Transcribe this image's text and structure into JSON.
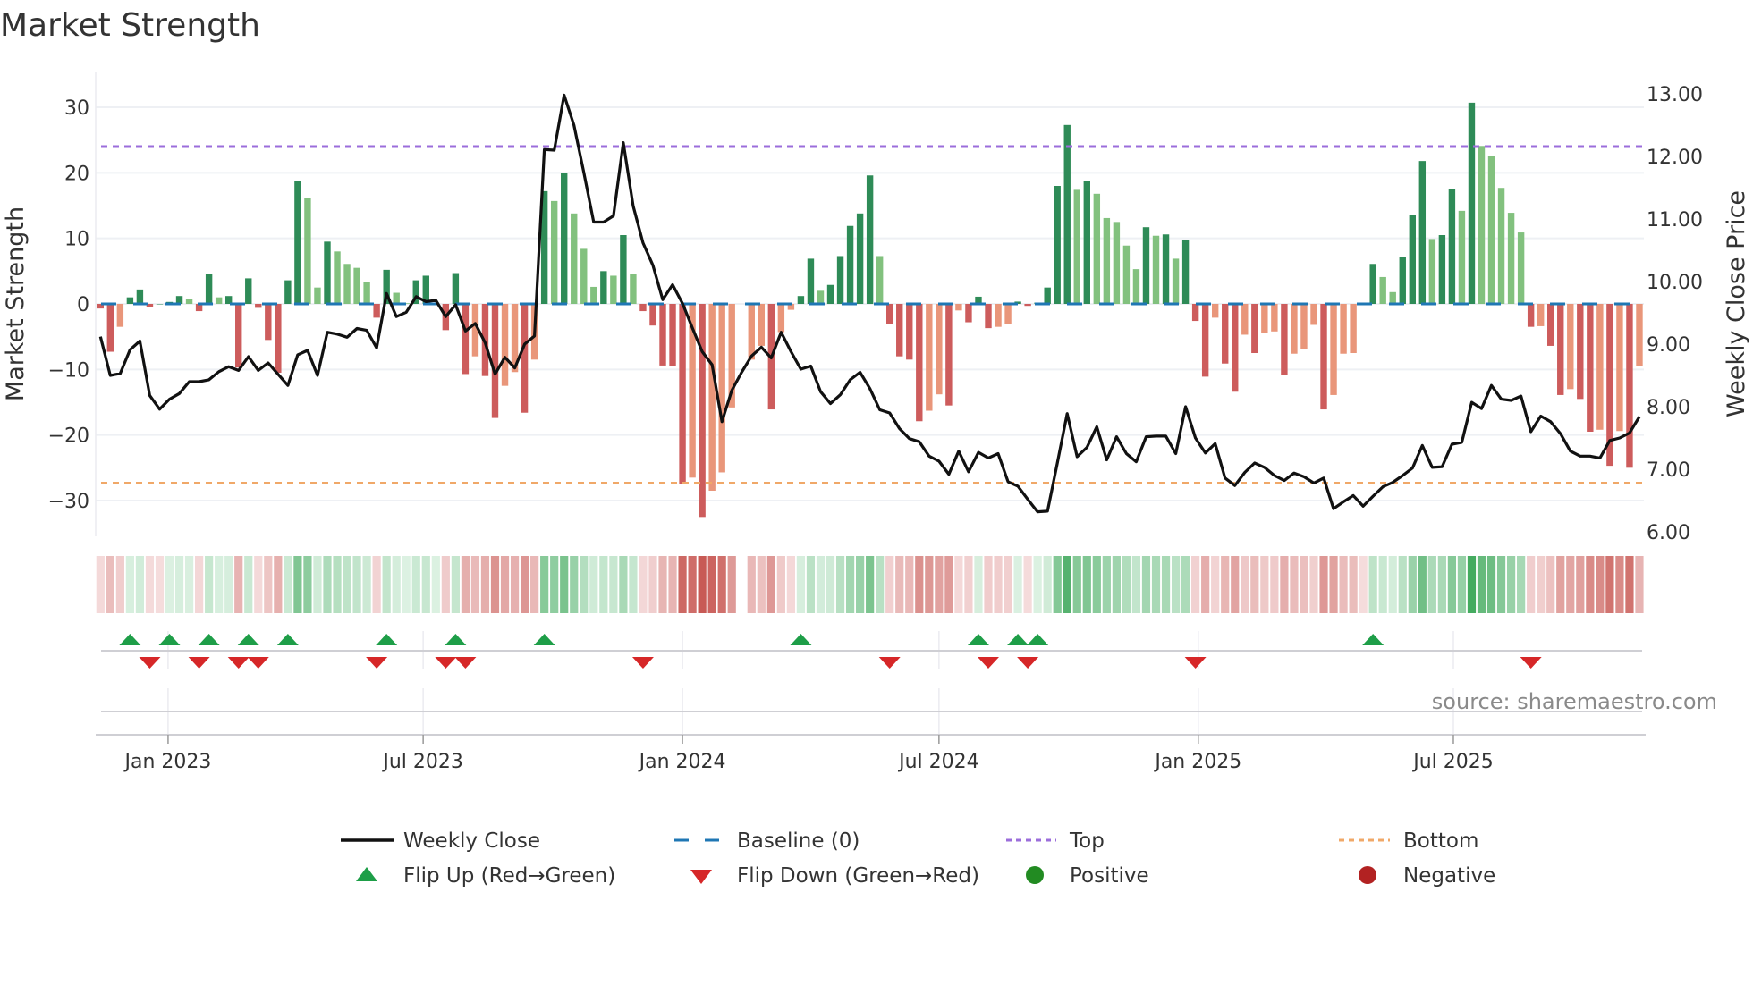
{
  "title": "Market Strength",
  "source": "source: sharemaestro.com",
  "colors": {
    "strong_up": "#2e8b57",
    "weak_up": "#82c17e",
    "strong_down": "#cd5c5c",
    "weak_down": "#e9967a",
    "baseline": "#1f77b4",
    "top": "#9b6ddb",
    "bottom": "#f0a868",
    "flip_up": "#1e9e48",
    "flip_down": "#d62728",
    "positive": "#228b22",
    "negative": "#b22222",
    "line": "#111111"
  },
  "legend": {
    "weekly_close": "Weekly Close",
    "baseline": "Baseline (0)",
    "top": "Top",
    "bottom": "Bottom",
    "flip_up": "Flip Up (Red→Green)",
    "flip_down": "Flip Down (Green→Red)",
    "positive": "Positive",
    "negative": "Negative"
  },
  "chart_data": {
    "type": "bar+line",
    "title": "Market Strength",
    "ylabel": "Market Strength",
    "y2label": "Weekly Close Price",
    "x_start": "2022-11-14",
    "x_step_days": 7,
    "ylim": [
      -35,
      35
    ],
    "y2lim": [
      5.72,
      13.35
    ],
    "y_ticks": [
      30,
      20,
      10,
      0,
      -10,
      -20,
      -30
    ],
    "y_tick_labels": [
      "30",
      "20",
      "10",
      "0",
      "−10",
      "−20",
      "−30"
    ],
    "y2_ticks": [
      13,
      12,
      11,
      10,
      9,
      8,
      7,
      6
    ],
    "y2_tick_labels": [
      "13.00",
      "12.00",
      "11.00",
      "10.00",
      "9.00",
      "8.00",
      "7.00",
      "6.00"
    ],
    "x_ticks": [
      "2023-01-01",
      "2023-07-01",
      "2024-01-01",
      "2024-07-01",
      "2025-01-01",
      "2025-07-01"
    ],
    "x_tick_labels": [
      "Jan 2023",
      "Jul 2023",
      "Jan 2024",
      "Jul 2024",
      "Jan 2025",
      "Jul 2025"
    ],
    "top_level": 24.0,
    "bottom_level": -27.3,
    "baseline": 0,
    "strength": [
      -0.7,
      -7.3,
      -3.5,
      1,
      2.2,
      -0.5,
      0,
      0.3,
      1.2,
      0.7,
      -1.1,
      4.5,
      1,
      1.2,
      -9.7,
      3.9,
      -0.6,
      -5.5,
      -10.5,
      3.6,
      18.8,
      16.1,
      2.5,
      9.5,
      8,
      6.1,
      5.5,
      3.3,
      -2.1,
      5.2,
      1.7,
      0.1,
      3.6,
      4.3,
      0.2,
      -4,
      4.7,
      -10.7,
      -8,
      -11,
      -17.4,
      -12.5,
      -10.4,
      -16.6,
      -8.5,
      17.2,
      15.7,
      20,
      13.8,
      8.4,
      2.6,
      5,
      4.3,
      10.5,
      4.6,
      -1.1,
      -3.3,
      -9.4,
      -9.5,
      -27.5,
      -26.5,
      -32.5,
      -28.5,
      -25.7,
      -15.8,
      null,
      -8.5,
      -6.4,
      -16.1,
      -4.3,
      -0.9,
      1.2,
      6.9,
      2,
      2.9,
      7.3,
      11.9,
      13.8,
      19.6,
      7.3,
      -3,
      -8,
      -8.5,
      -17.9,
      -16.3,
      -13.8,
      -15.5,
      -1,
      -2.8,
      1.1,
      -3.7,
      -3.5,
      -3,
      0.35,
      -0.3,
      0.2,
      2.5,
      18,
      27.3,
      17.4,
      18.8,
      16.8,
      13.1,
      12.5,
      8.9,
      5.3,
      11.7,
      10.4,
      10.6,
      6.9,
      9.8,
      -2.6,
      -11.1,
      -2.1,
      -9.1,
      -13.4,
      -4.7,
      -7.5,
      -4.5,
      -4.2,
      -10.9,
      -7.6,
      -6.9,
      -3.2,
      -16.1,
      -13.9,
      -7.6,
      -7.5,
      -0.1,
      6.1,
      4.1,
      1.8,
      7.2,
      13.5,
      21.8,
      9.9,
      10.5,
      17.5,
      14.2,
      30.7,
      24.1,
      22.6,
      17.7,
      13.9,
      10.9,
      -3.5,
      -3.4,
      -6.4,
      -13.9,
      -13,
      -14.5,
      -19.5,
      -19.2,
      -24.7,
      -19.4,
      -25,
      -9.5
    ],
    "weekly_close": [
      9.12,
      8.5,
      8.53,
      8.91,
      9.05,
      8.18,
      7.96,
      8.12,
      8.21,
      8.4,
      8.4,
      8.43,
      8.56,
      8.64,
      8.58,
      8.8,
      8.58,
      8.7,
      8.52,
      8.34,
      8.83,
      8.9,
      8.5,
      9.19,
      9.16,
      9.11,
      9.25,
      9.22,
      8.94,
      9.81,
      9.44,
      9.51,
      9.76,
      9.68,
      9.7,
      9.44,
      9.63,
      9.21,
      9.33,
      9.02,
      8.52,
      8.79,
      8.62,
      9.0,
      9.13,
      12.11,
      12.1,
      12.98,
      12.5,
      11.74,
      10.95,
      10.95,
      11.05,
      12.22,
      11.21,
      10.62,
      10.26,
      9.71,
      9.95,
      9.65,
      9.26,
      8.88,
      8.67,
      7.76,
      8.26,
      8.55,
      8.81,
      8.95,
      8.78,
      9.19,
      8.88,
      8.6,
      8.65,
      8.24,
      8.05,
      8.19,
      8.43,
      8.55,
      8.29,
      7.95,
      7.9,
      7.65,
      7.49,
      7.44,
      7.21,
      7.13,
      6.92,
      7.29,
      6.96,
      7.27,
      7.18,
      7.25,
      6.8,
      6.73,
      6.52,
      6.32,
      6.33,
      7.1,
      7.89,
      7.2,
      7.35,
      7.68,
      7.15,
      7.52,
      7.25,
      7.12,
      7.52,
      7.53,
      7.53,
      7.25,
      8.0,
      7.5,
      7.26,
      7.41,
      6.86,
      6.74,
      6.95,
      7.1,
      7.03,
      6.9,
      6.82,
      6.94,
      6.88,
      6.78,
      6.86,
      6.37,
      6.48,
      6.58,
      6.41,
      6.57,
      6.72,
      6.79,
      6.9,
      7.02,
      7.38,
      7.03,
      7.04,
      7.4,
      7.43,
      8.07,
      7.97,
      8.34,
      8.12,
      8.1,
      8.17,
      7.6,
      7.85,
      7.76,
      7.57,
      7.29,
      7.21,
      7.21,
      7.18,
      7.46,
      7.5,
      7.58,
      7.84
    ],
    "flip_up_weeks": [
      3,
      7,
      11,
      15,
      19,
      29,
      36,
      45,
      71,
      89,
      93,
      95,
      129
    ],
    "flip_down_weeks": [
      5,
      10,
      14,
      16,
      28,
      35,
      37,
      55,
      80,
      90,
      94,
      111,
      145
    ],
    "grid": true,
    "legend_position": "bottom"
  }
}
